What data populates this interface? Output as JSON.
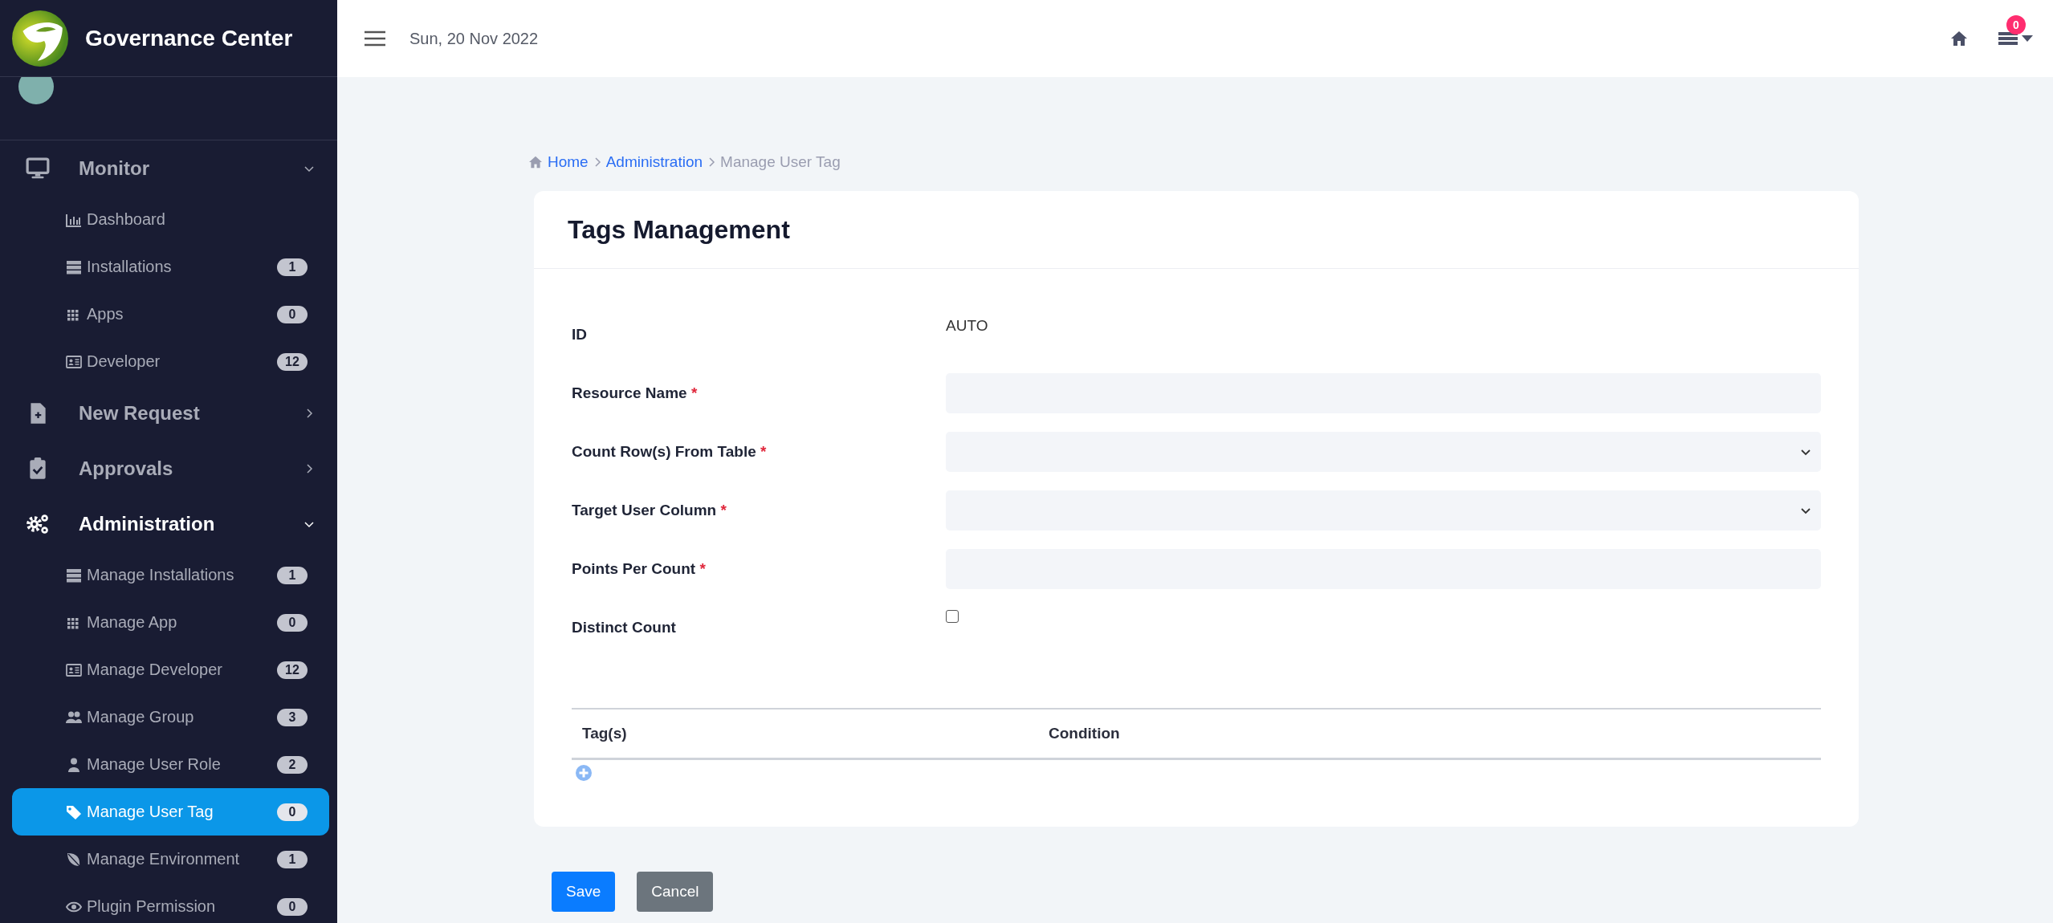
{
  "brand": {
    "title": "Governance Center"
  },
  "sidebar": {
    "groups": [
      {
        "label": "Monitor",
        "expanded": true,
        "selected": false,
        "items": [
          {
            "label": "Dashboard",
            "selected": false
          },
          {
            "label": "Installations",
            "badge": "1",
            "selected": false
          },
          {
            "label": "Apps",
            "badge": "0",
            "selected": false
          },
          {
            "label": "Developer",
            "badge": "12",
            "selected": false
          }
        ]
      },
      {
        "label": "New Request",
        "expanded": false,
        "selected": false
      },
      {
        "label": "Approvals",
        "expanded": false,
        "selected": false
      },
      {
        "label": "Administration",
        "expanded": true,
        "selected": true,
        "items": [
          {
            "label": "Manage Installations",
            "badge": "1",
            "selected": false
          },
          {
            "label": "Manage App",
            "badge": "0",
            "selected": false
          },
          {
            "label": "Manage Developer",
            "badge": "12",
            "selected": false
          },
          {
            "label": "Manage Group",
            "badge": "3",
            "selected": false
          },
          {
            "label": "Manage User Role",
            "badge": "2",
            "selected": false
          },
          {
            "label": "Manage User Tag",
            "badge": "0",
            "selected": true
          },
          {
            "label": "Manage Environment",
            "badge": "1",
            "selected": false
          },
          {
            "label": "Plugin Permission",
            "badge": "0",
            "selected": false
          }
        ]
      }
    ]
  },
  "header": {
    "date": "Sun, 20 Nov 2022",
    "notification_count": "0"
  },
  "breadcrumb": [
    {
      "label": "Home",
      "kind": "link"
    },
    {
      "label": "Administration",
      "kind": "link"
    },
    {
      "label": "Manage User Tag",
      "kind": "current"
    }
  ],
  "card": {
    "title": "Tags Management",
    "fields": [
      {
        "label": "ID",
        "kind": "static",
        "value": "AUTO"
      },
      {
        "label": "Resource Name",
        "kind": "input",
        "required_mark": "*"
      },
      {
        "label": "Count Row(s) From Table",
        "kind": "select",
        "required_mark": "*"
      },
      {
        "label": "Target User Column",
        "kind": "select",
        "required_mark": "*"
      },
      {
        "label": "Points Per Count",
        "kind": "input",
        "required_mark": "*"
      },
      {
        "label": "Distinct Count",
        "kind": "checkbox",
        "checked": false
      }
    ],
    "table": {
      "columns": [
        "Tag(s)",
        "Condition"
      ]
    }
  },
  "buttons": [
    {
      "label": "Save",
      "kind": "primary"
    },
    {
      "label": "Cancel",
      "kind": "secondary"
    }
  ]
}
